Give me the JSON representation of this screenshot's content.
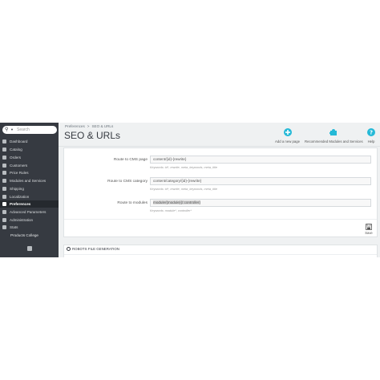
{
  "search": {
    "placeholder": "Search"
  },
  "sidebar": {
    "items": [
      {
        "label": "Dashboard",
        "icon": "trending-up-icon"
      },
      {
        "label": "Catalog",
        "icon": "store-icon"
      },
      {
        "label": "Orders",
        "icon": "credit-card-icon"
      },
      {
        "label": "Customers",
        "icon": "users-icon"
      },
      {
        "label": "Price Rules",
        "icon": "tag-icon"
      },
      {
        "label": "Modules and Services",
        "icon": "puzzle-icon"
      },
      {
        "label": "Shipping",
        "icon": "truck-icon"
      },
      {
        "label": "Localization",
        "icon": "globe-icon"
      },
      {
        "label": "Preferences",
        "icon": "wrench-icon",
        "active": true
      },
      {
        "label": "Advanced Parameters",
        "icon": "gears-icon"
      },
      {
        "label": "Administration",
        "icon": "cog-icon"
      },
      {
        "label": "Stats",
        "icon": "bar-chart-icon"
      },
      {
        "label": "Products College",
        "icon": "none",
        "sub": true
      }
    ]
  },
  "breadcrumb": {
    "parent": "Preferences",
    "current": "SEO & URLs"
  },
  "page": {
    "title": "SEO & URLs"
  },
  "toolbar": {
    "add_new_page": "Add a new page",
    "recommended": "Recommended Modules and Services",
    "help": "Help"
  },
  "form": {
    "rows": [
      {
        "label": "Route to CMS page",
        "value": "content/{id}-{rewrite}",
        "help": "Keywords: id*, rewrite, meta_keywords, meta_title"
      },
      {
        "label": "Route to CMS category",
        "value": "content/category/{id}-{rewrite}",
        "help": "Keywords: id*, rewrite, meta_keywords, meta_title"
      },
      {
        "label": "Route to modules",
        "value": "module/{module}{/:controller}",
        "help": "Keywords: module*, controller*"
      }
    ],
    "save_label": "Save"
  },
  "robots": {
    "header": "ROBOTS FILE GENERATION"
  },
  "colors": {
    "sidebar_bg": "#363a41",
    "sidebar_active_bg": "#25292e",
    "accent": "#25b9d7",
    "background": "#eff1f2"
  }
}
